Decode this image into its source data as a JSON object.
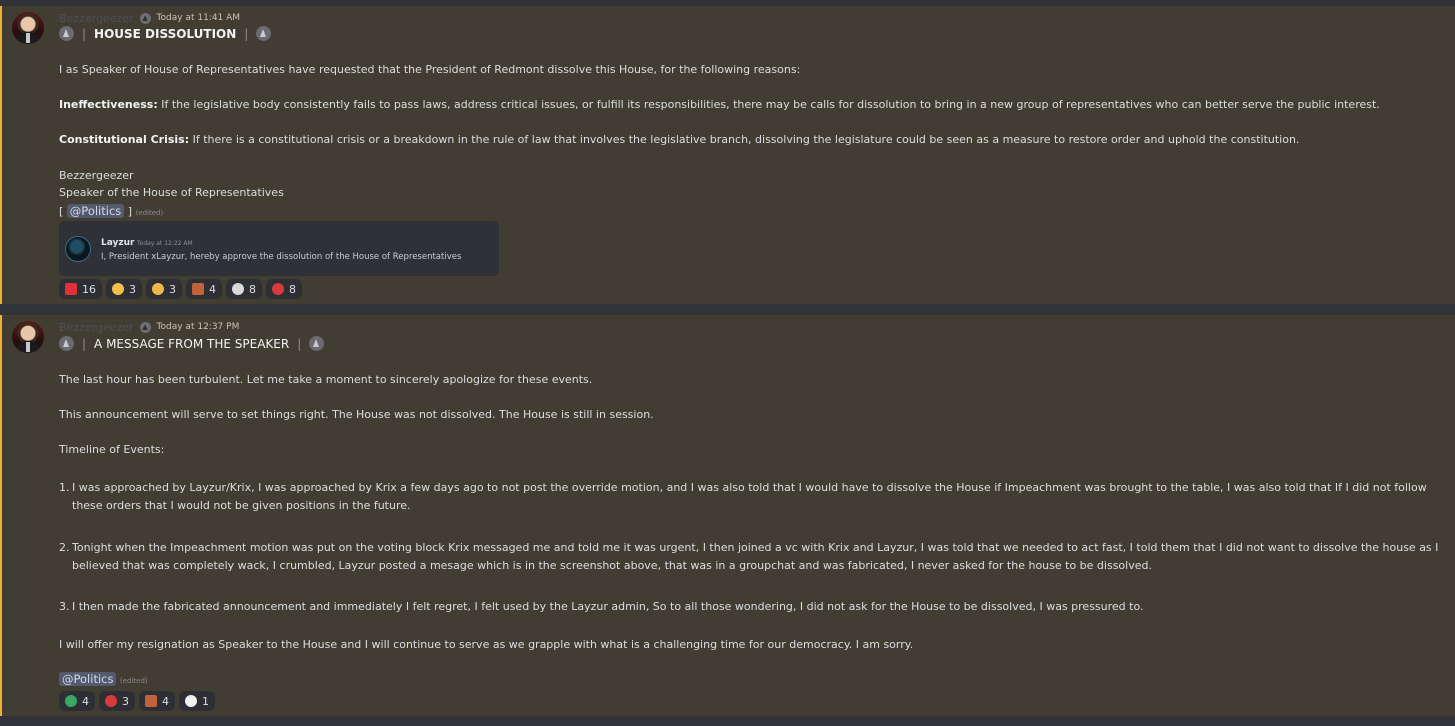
{
  "messages": [
    {
      "username": "Bezzergeezer",
      "timestamp": "Today at 11:41 AM",
      "title": "HOUSE DISSOLUTION",
      "intro": "I as Speaker of House of Representatives have requested that the President of Redmont dissolve this House, for the following reasons:",
      "reasons": [
        {
          "label": "Ineffectiveness:",
          "text": " If the legislative body consistently fails to pass laws, address critical issues, or fulfill its responsibilities, there may be calls for dissolution to bring in a new group of representatives who can better serve the public interest."
        },
        {
          "label": "Constitutional Crisis:",
          "text": " If there is a constitutional crisis or a breakdown in the rule of law that involves the legislative branch, dissolving the legislature could be seen as a measure to restore order and uphold the constitution."
        }
      ],
      "signature_name": "Bezzergeezer",
      "signature_role": "Speaker of the House of Representatives",
      "bracket_open": "[",
      "mention": "@Politics",
      "bracket_close": "]",
      "edited": "(edited)",
      "embed": {
        "author": "Layzur",
        "time": "Today at 12:22 AM",
        "text": "I, President xLayzur, hereby approve the dissolution of the House of Representatives"
      },
      "reactions": [
        {
          "emoji": "red-flag-emoji",
          "color": "#e0303a",
          "count": "16"
        },
        {
          "emoji": "thinking-face-emoji",
          "color": "#f5c04a",
          "count": "3"
        },
        {
          "emoji": "anxious-face-emoji",
          "color": "#f0b84a",
          "count": "3"
        },
        {
          "emoji": "brick-emoji",
          "color": "#c0623a",
          "count": "4"
        },
        {
          "emoji": "skull-emoji",
          "color": "#d9d9d9",
          "count": "8"
        },
        {
          "emoji": "stop-sign-emoji",
          "color": "#d93a3a",
          "count": "8"
        }
      ]
    },
    {
      "username": "Bezzergeezer",
      "timestamp": "Today at 12:37 PM",
      "title": "A MESSAGE FROM THE SPEAKER",
      "para1": "The last hour has been turbulent. Let me take a moment to sincerely apologize for these events.",
      "para2": "This announcement will serve to set things right. The House was not dissolved. The House is still in session.",
      "para3": "Timeline of Events:",
      "items": [
        {
          "num": "1.",
          "text": "I was approached by Layzur/Krix, I was approached by Krix a few days ago to not post the override motion, and I was also told that I would have to dissolve the House if Impeachment was brought to the table, I was also told that If I did not follow these orders that I would not be given positions in the future."
        },
        {
          "num": "2.",
          "text": "Tonight when the Impeachment motion was put on the voting block Krix messaged me and told me it was urgent, I then joined a vc with Krix and Layzur, I was told that we needed to act fast, I told them that I did not want to dissolve the house as I believed that was completely wack, I crumbled, Layzur posted a mesage which is in the screenshot above, that was in a groupchat and was fabricated, I never asked for the house to be dissolved."
        },
        {
          "num": "3.",
          "text": "I then made the fabricated announcement and immediately I felt regret, I felt used by the Layzur admin, So to all those wondering, I did not ask for the House to be dissolved, I was pressured to."
        }
      ],
      "para4": "I will offer my resignation as Speaker to the House and I will continue to serve as we grapple with what is a challenging time for our democracy. I am sorry.",
      "mention": "@Politics",
      "edited": "(edited)",
      "reactions": [
        {
          "emoji": "green-circle-emoji",
          "color": "#3aa860",
          "count": "4"
        },
        {
          "emoji": "stop-sign-emoji",
          "color": "#d93a3a",
          "count": "3"
        },
        {
          "emoji": "brick-emoji",
          "color": "#c0623a",
          "count": "4"
        },
        {
          "emoji": "eyes-emoji",
          "color": "#f2f2f2",
          "count": "1"
        }
      ]
    }
  ]
}
